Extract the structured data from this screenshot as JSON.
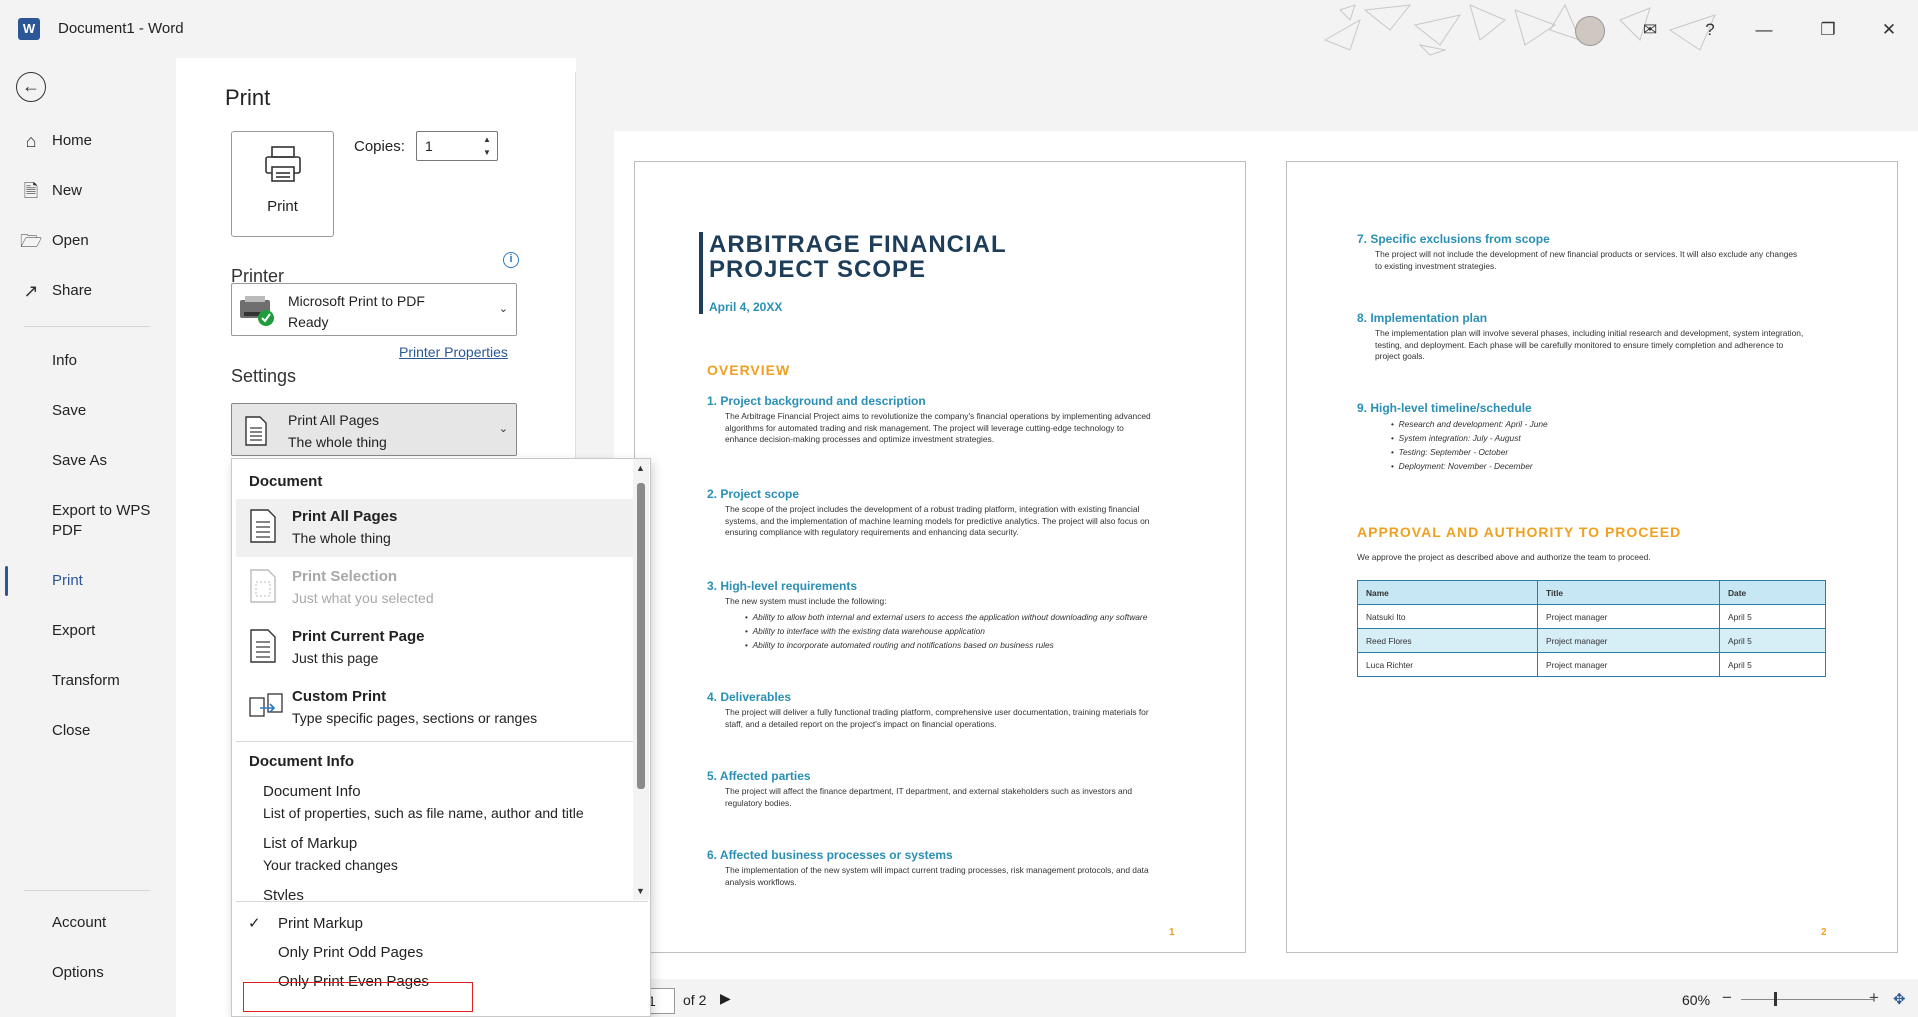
{
  "window": {
    "title": "Document1  -  Word",
    "app_icon": "W",
    "help": "?"
  },
  "nav": {
    "primary": [
      {
        "label": "Home",
        "icon": "home-icon"
      },
      {
        "label": "New",
        "icon": "new-document-icon"
      },
      {
        "label": "Open",
        "icon": "folder-open-icon"
      },
      {
        "label": "Share",
        "icon": "share-icon"
      }
    ],
    "secondary": [
      "Info",
      "Save",
      "Save As",
      "Export to WPS",
      "PDF",
      "Print",
      "Export",
      "Transform",
      "Close"
    ],
    "footer": [
      "Account",
      "Options"
    ],
    "selected": "Print"
  },
  "print": {
    "title": "Print",
    "print_button": "Print",
    "copies_label": "Copies:",
    "copies_value": "1",
    "printer_heading": "Printer",
    "printer_name": "Microsoft Print to PDF",
    "printer_status": "Ready",
    "printer_properties": "Printer Properties",
    "settings_heading": "Settings",
    "pages_selected_title": "Print All Pages",
    "pages_selected_desc": "The whole thing"
  },
  "dropdown": {
    "group1": "Document",
    "items": [
      {
        "title": "Print All Pages",
        "desc": "The whole thing",
        "enabled": true,
        "highlighted": true
      },
      {
        "title": "Print Selection",
        "desc": "Just what you selected",
        "enabled": false
      },
      {
        "title": "Print Current Page",
        "desc": "Just this page",
        "enabled": true
      },
      {
        "title": "Custom Print",
        "desc": "Type specific pages, sections or ranges",
        "enabled": true
      }
    ],
    "group2": "Document Info",
    "info_items": [
      {
        "title": "Document Info",
        "desc": "List of properties, such as file name, author and title"
      },
      {
        "title": "List of Markup",
        "desc": "Your tracked changes"
      },
      {
        "title": "Styles",
        "desc": ""
      }
    ],
    "options": [
      {
        "label": "Print Markup",
        "checked": true
      },
      {
        "label": "Only Print Odd Pages",
        "checked": false
      },
      {
        "label": "Only Print Even Pages",
        "checked": false
      }
    ],
    "checkmark": "✓"
  },
  "preview": {
    "page1": {
      "title_line1": "ARBITRAGE FINANCIAL",
      "title_line2": "PROJECT SCOPE",
      "date": "April 4, 20XX",
      "overview": "OVERVIEW",
      "s1_h": "1.  Project background and description",
      "s1_b": "The Arbitrage Financial Project aims to revolutionize the company's financial operations by implementing advanced algorithms for automated trading and risk management. The project will leverage cutting-edge technology to enhance decision-making processes and optimize investment strategies.",
      "s2_h": "2.  Project scope",
      "s2_b": "The scope of the project includes the development of a robust trading platform, integration with existing financial systems, and the implementation of machine learning models for predictive analytics. The project will also focus on ensuring compliance with regulatory requirements and enhancing data security.",
      "s3_h": "3.  High-level requirements",
      "s3_b": "The new system must include the following:",
      "s3_bullets": [
        "Ability to allow both internal and external users to access the application without downloading any software",
        "Ability to interface with the existing data warehouse application",
        "Ability to incorporate automated routing and notifications based on business rules"
      ],
      "s4_h": "4.  Deliverables",
      "s4_b": "The project will deliver a fully functional trading platform, comprehensive user documentation, training materials for staff, and a detailed report on the project's impact on financial operations.",
      "s5_h": "5.   Affected parties",
      "s5_b": "The project will affect the finance department, IT department, and external stakeholders such as investors and regulatory bodies.",
      "s6_h": "6.  Affected business processes or systems",
      "s6_b": "The implementation of the new system will impact current trading processes, risk management protocols, and data analysis workflows.",
      "page_num": "1"
    },
    "page2": {
      "s7_h": "7.  Specific exclusions from scope",
      "s7_b": "The project will not include the development of new financial products or services. It will also exclude any changes to existing investment strategies.",
      "s8_h": "8.  Implementation plan",
      "s8_b": "The implementation plan will involve several phases, including initial research and development, system integration, testing, and deployment. Each phase will be carefully monitored to ensure timely completion and adherence to project goals.",
      "s9_h": "9.  High-level timeline/schedule",
      "s9_bullets": [
        "Research and development: April - June",
        "System integration: July - August",
        "Testing: September - October",
        "Deployment: November - December"
      ],
      "approval_h": "APPROVAL AND AUTHORITY TO PROCEED",
      "approval_b": "We approve the project as described above and authorize the team to proceed.",
      "table_headers": [
        "Name",
        "Title",
        "Date"
      ],
      "table_rows": [
        [
          "Natsuki Ito",
          "Project manager",
          "April 5"
        ],
        [
          "Reed Flores",
          "Project manager",
          "April 5"
        ],
        [
          "Luca Richter",
          "Project manager",
          "April 5"
        ]
      ],
      "page_num": "2"
    }
  },
  "footer": {
    "current_page": "1",
    "of_pages": "of 2",
    "zoom": "60%",
    "zoom_minus": "−",
    "zoom_plus": "+"
  },
  "colors": {
    "accent": "#2b5797",
    "doc_title": "#1e3d59",
    "doc_heading": "#2a8fb5",
    "doc_orange": "#f0a020",
    "highlight_outline": "#e02020"
  }
}
